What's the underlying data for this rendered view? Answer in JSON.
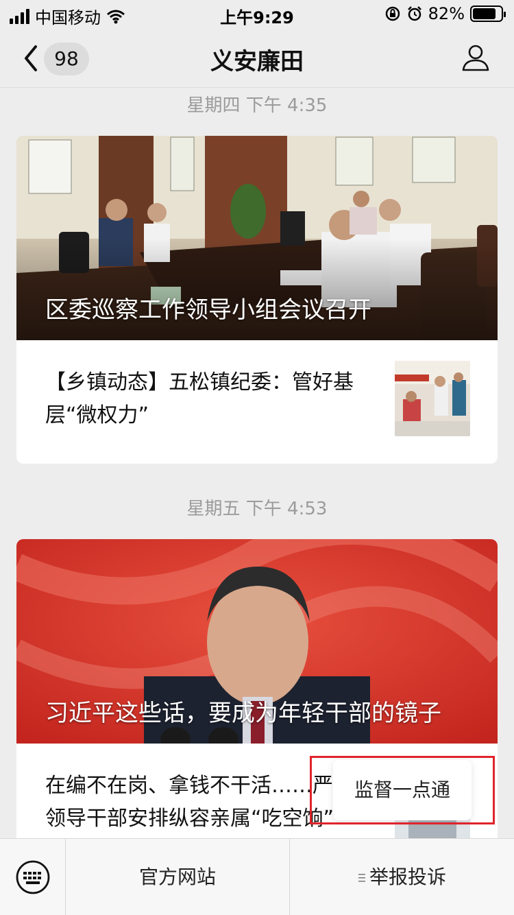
{
  "status_bar": {
    "carrier": "中国移动",
    "time": "上午9:29",
    "battery": "82%",
    "battery_level": 0.82
  },
  "nav": {
    "unread_count": "98",
    "title": "义安廉田"
  },
  "feed": [
    {
      "timestamp": "星期四 下午 4:35",
      "headline": "区委巡察工作领导小组会议召开",
      "secondary": "【乡镇动态】五松镇纪委：管好基层“微权力”"
    },
    {
      "timestamp": "星期五 下午 4:53",
      "headline": "习近平这些话，要成为年轻干部的镜子",
      "secondary": "在编不在岗、拿钱不干活……严禁领导干部安排纵容亲属“吃空饷”"
    }
  ],
  "menu": {
    "item1": "官方网站",
    "item2": "举报投诉",
    "submenu_item": "监督一点通"
  },
  "colors": {
    "background": "#ededed",
    "highlight_border": "#e0242b"
  },
  "icons": [
    "back-chevron-icon",
    "profile-icon",
    "keyboard-icon",
    "menu-list-icon",
    "signal-icon",
    "wifi-icon",
    "orientation-lock-icon",
    "alarm-icon"
  ]
}
